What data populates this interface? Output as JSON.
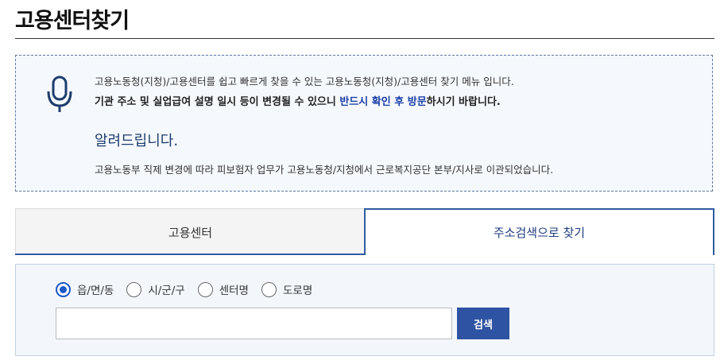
{
  "page": {
    "title": "고용센터찾기"
  },
  "notice": {
    "icon": "microphone-icon",
    "line1": "고용노동청(지청)/고용센터를 쉽고 빠르게 찾을 수 있는 고용노동청(지청)/고용센터 찾기 메뉴 입니다.",
    "line2_prefix": "기관 주소 및 실업급여 설명 일시 등이 변경될 수 있으니 ",
    "line2_highlight": "반드시 확인 후 방문",
    "line2_suffix": "하시기 바랍니다.",
    "heading": "알려드립니다.",
    "line3": "고용노동부 직제 변경에 따라 피보험자 업무가 고용노동청/지청에서 근로복지공단 본부/지사로 이관되었습니다."
  },
  "tabs": [
    {
      "label": "고용센터",
      "active": false
    },
    {
      "label": "주소검색으로 찾기",
      "active": true
    }
  ],
  "search": {
    "options": [
      {
        "label": "읍/면/동",
        "checked": true
      },
      {
        "label": "시/군/구",
        "checked": false
      },
      {
        "label": "센터명",
        "checked": false
      },
      {
        "label": "도로명",
        "checked": false
      }
    ],
    "input_value": "",
    "button_label": "검색"
  },
  "colors": {
    "accent": "#2f5ba0",
    "button": "#2f53a3",
    "highlight": "#1a3fa8"
  }
}
